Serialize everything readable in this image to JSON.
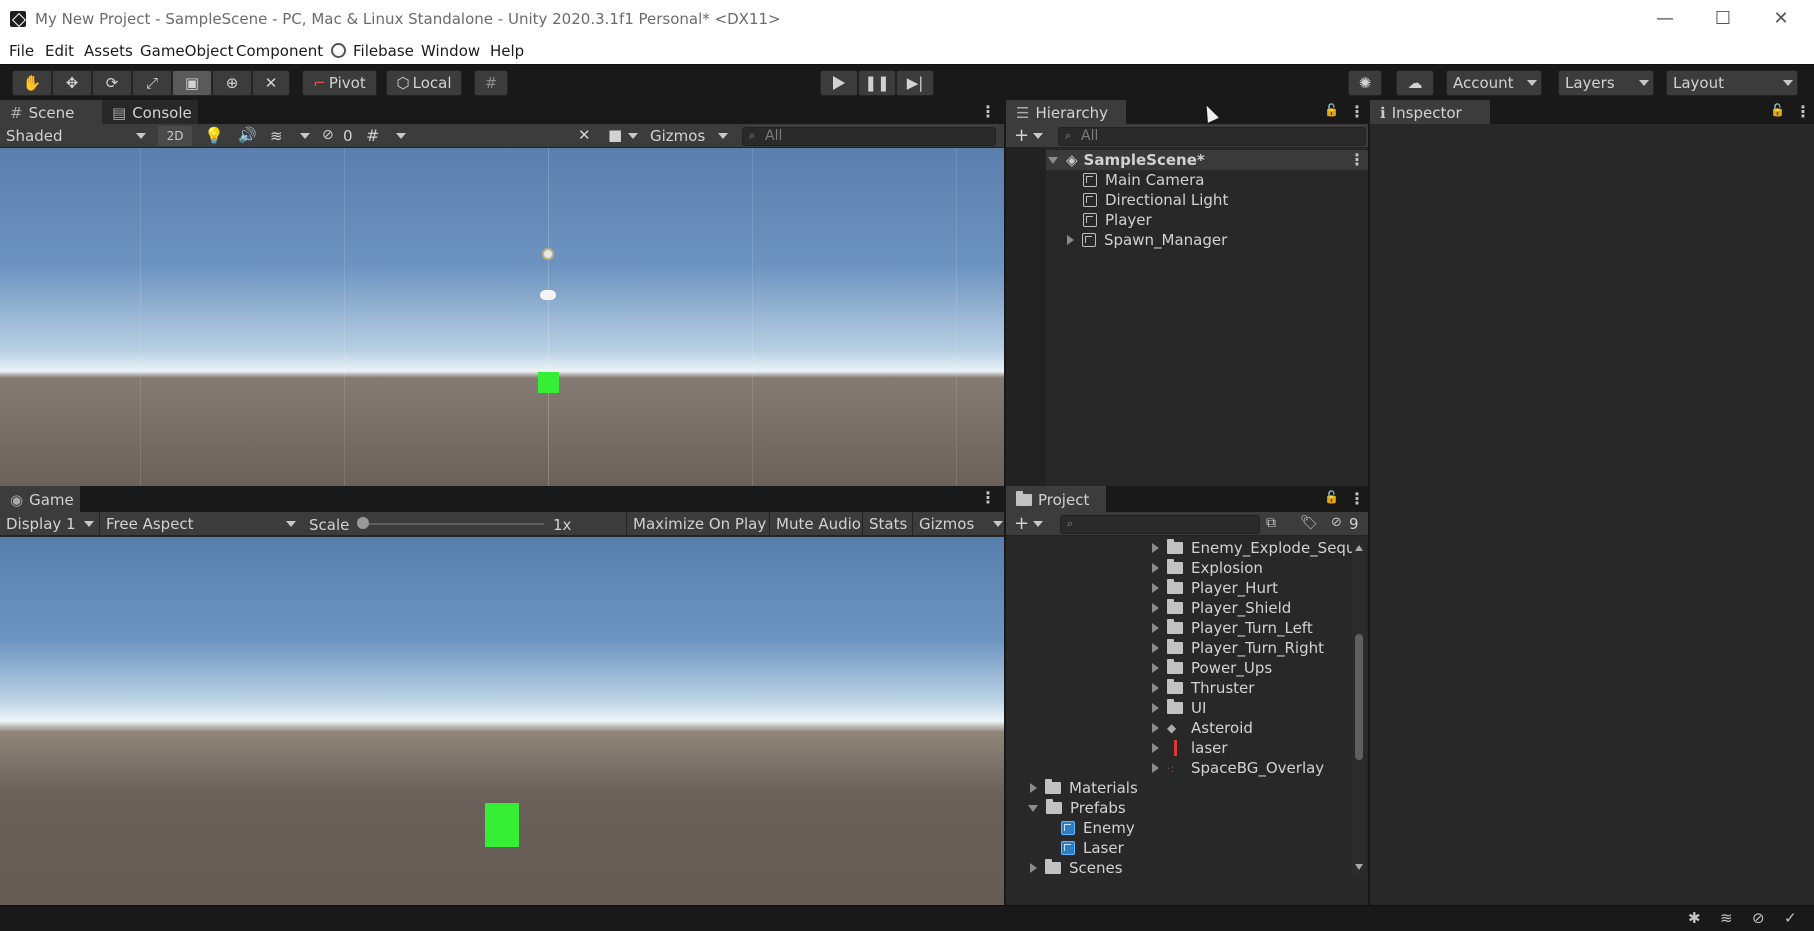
{
  "window": {
    "title": "My New Project - SampleScene - PC, Mac & Linux Standalone - Unity 2020.3.1f1 Personal* <DX11>",
    "minimize": "—",
    "maximize": "☐",
    "close": "✕"
  },
  "menu": [
    "File",
    "Edit",
    "Assets",
    "GameObject",
    "Component",
    "Filebase",
    "Window",
    "Help"
  ],
  "toolbar": {
    "pivot": "Pivot",
    "local": "Local",
    "account": "Account",
    "layers": "Layers",
    "layout": "Layout"
  },
  "scene_panel": {
    "tabs": [
      "Scene",
      "Console"
    ],
    "shading": "Shaded",
    "mode_2d": "2D",
    "hidden_count": "0",
    "gizmos": "Gizmos",
    "search_placeholder": "All"
  },
  "game_panel": {
    "tab": "Game",
    "display": "Display 1",
    "aspect": "Free Aspect",
    "scale_label": "Scale",
    "scale_value": "1x",
    "maximize": "Maximize On Play",
    "mute": "Mute Audio",
    "stats": "Stats",
    "gizmos": "Gizmos"
  },
  "hierarchy": {
    "tab": "Hierarchy",
    "search_placeholder": "All",
    "scene": "SampleScene*",
    "items": [
      "Main Camera",
      "Directional Light",
      "Player",
      "Spawn_Manager"
    ]
  },
  "inspector": {
    "tab": "Inspector"
  },
  "project": {
    "tab": "Project",
    "hidden_count": "9",
    "items": [
      {
        "label": "Enemy_Explode_Seque",
        "kind": "folder"
      },
      {
        "label": "Explosion",
        "kind": "folder"
      },
      {
        "label": "Player_Hurt",
        "kind": "folder"
      },
      {
        "label": "Player_Shield",
        "kind": "folder"
      },
      {
        "label": "Player_Turn_Left",
        "kind": "folder"
      },
      {
        "label": "Player_Turn_Right",
        "kind": "folder"
      },
      {
        "label": "Power_Ups",
        "kind": "folder"
      },
      {
        "label": "Thruster",
        "kind": "folder"
      },
      {
        "label": "UI",
        "kind": "folder"
      },
      {
        "label": "Asteroid",
        "kind": "sprite"
      },
      {
        "label": "laser",
        "kind": "sprite"
      },
      {
        "label": "SpaceBG_Overlay",
        "kind": "sprite"
      },
      {
        "label": "Materials",
        "kind": "folder"
      },
      {
        "label": "Prefabs",
        "kind": "folder-open"
      },
      {
        "label": "Enemy",
        "kind": "prefab"
      },
      {
        "label": "Laser",
        "kind": "prefab"
      },
      {
        "label": "Scenes",
        "kind": "folder"
      }
    ]
  },
  "colors": {
    "player_green": "#35ee35",
    "sky_top": "#5f86b5",
    "ground": "#6a615a"
  }
}
